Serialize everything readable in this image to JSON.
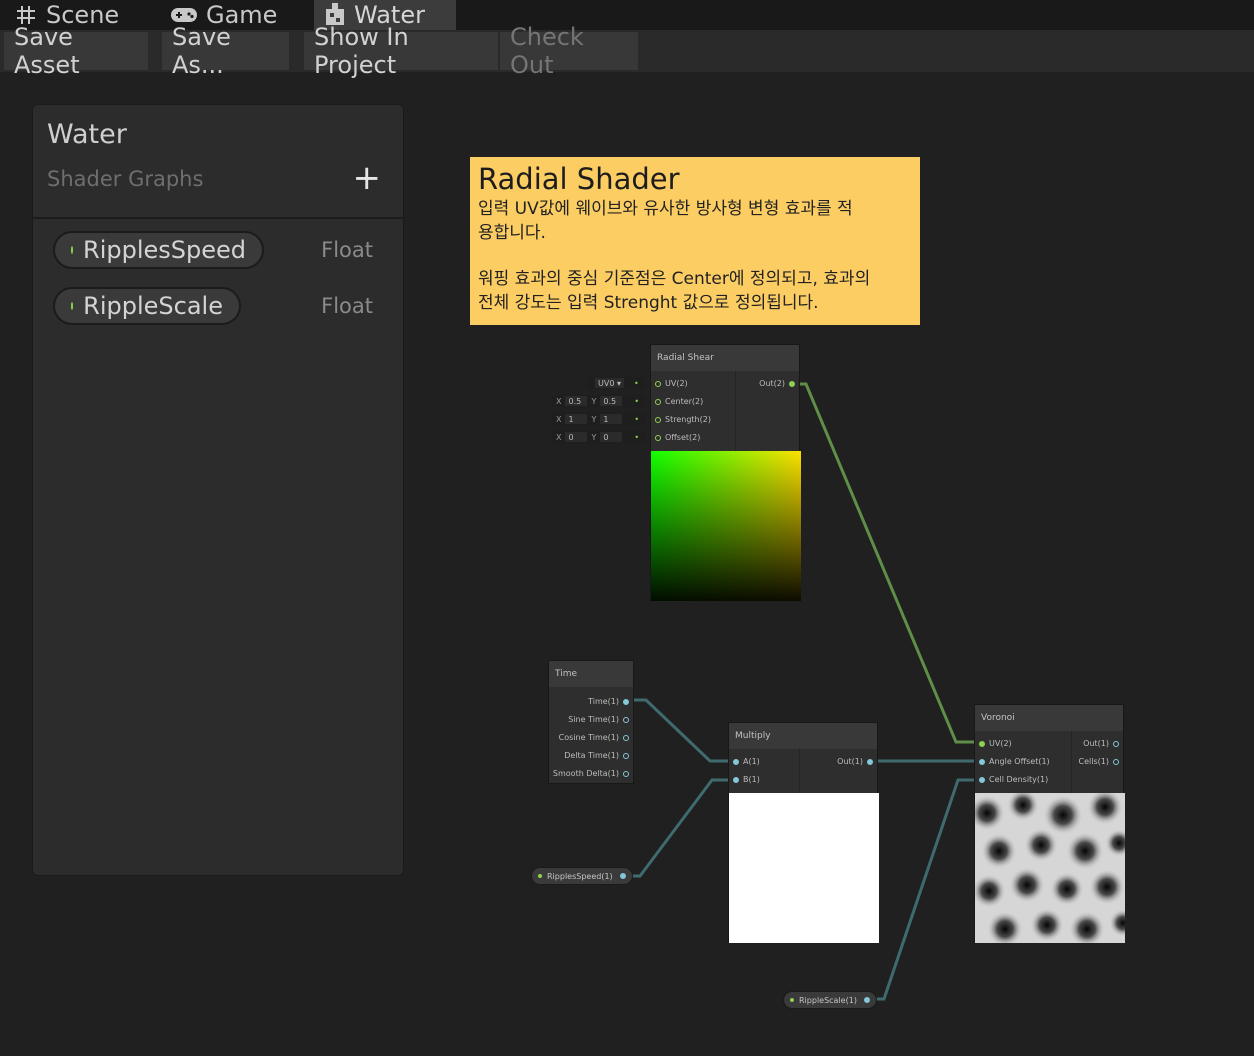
{
  "tabs": [
    {
      "label": "Scene",
      "icon": "hash-icon"
    },
    {
      "label": "Game",
      "icon": "gamepad-icon"
    },
    {
      "label": "Water",
      "icon": "shader-graph-icon"
    }
  ],
  "toolbar": {
    "save_asset": "Save Asset",
    "save_as": "Save As...",
    "show_in_project": "Show In Project",
    "check_out": "Check Out"
  },
  "blackboard": {
    "title": "Water",
    "subtitle": "Shader Graphs",
    "add_icon": "+",
    "properties": [
      {
        "name": "RipplesSpeed",
        "type": "Float"
      },
      {
        "name": "RippleScale",
        "type": "Float"
      }
    ]
  },
  "sticky": {
    "title": "Radial Shader",
    "line1": "입력 UV값에 웨이브와 유사한 방사형 변형 효과를 적",
    "line2": "용합니다.",
    "line3": "워핑 효과의 중심 기준점은 Center에 정의되고, 효과의",
    "line4": "전체 강도는 입력 Strenght 값으로 정의됩니다."
  },
  "nodes": {
    "radial_shear": {
      "title": "Radial Shear",
      "inputs": [
        "UV(2)",
        "Center(2)",
        "Strength(2)",
        "Offset(2)"
      ],
      "output": "Out(2)",
      "uv_default": "UV0",
      "center": {
        "x_label": "X",
        "x": "0.5",
        "y_label": "Y",
        "y": "0.5"
      },
      "strength": {
        "x_label": "X",
        "x": "1",
        "y_label": "Y",
        "y": "1"
      },
      "offset": {
        "x_label": "X",
        "x": "0",
        "y_label": "Y",
        "y": "0"
      }
    },
    "time": {
      "title": "Time",
      "outputs": [
        "Time(1)",
        "Sine Time(1)",
        "Cosine Time(1)",
        "Delta Time(1)",
        "Smooth Delta(1)"
      ]
    },
    "multiply": {
      "title": "Multiply",
      "inputs": [
        "A(1)",
        "B(1)"
      ],
      "output": "Out(1)"
    },
    "voronoi": {
      "title": "Voronoi",
      "inputs": [
        "UV(2)",
        "Angle Offset(1)",
        "Cell Density(1)"
      ],
      "outputs": [
        "Out(1)",
        "Cells(1)"
      ]
    },
    "ripples_speed_prop": "RipplesSpeed(1)",
    "ripple_scale_prop": "RippleScale(1)"
  },
  "colors": {
    "sticky": "#fccd62",
    "vector2_wire": "#5e8e47",
    "float_wire": "#3f6b6e",
    "float_pin": "#84c7d9",
    "vector2_pin": "#8fd14f"
  }
}
